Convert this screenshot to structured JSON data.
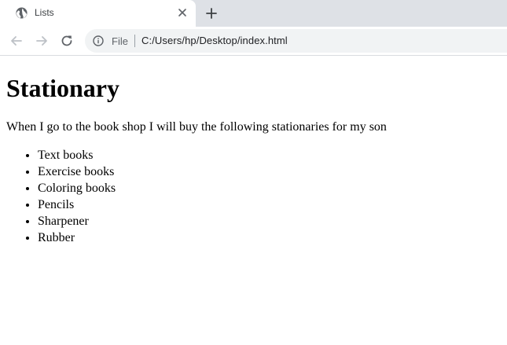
{
  "tab": {
    "title": "Lists",
    "favicon": "globe-icon"
  },
  "toolbar": {
    "back": "arrow-left-icon",
    "forward": "arrow-right-icon",
    "reload": "reload-icon",
    "scheme_label": "File",
    "url": "C:/Users/hp/Desktop/index.html"
  },
  "page": {
    "heading": "Stationary",
    "paragraph": "When I go to the book shop I will buy the following stationaries for my son",
    "items": [
      "Text books",
      "Exercise books",
      "Coloring books",
      "Pencils",
      "Sharpener",
      "Rubber"
    ]
  }
}
